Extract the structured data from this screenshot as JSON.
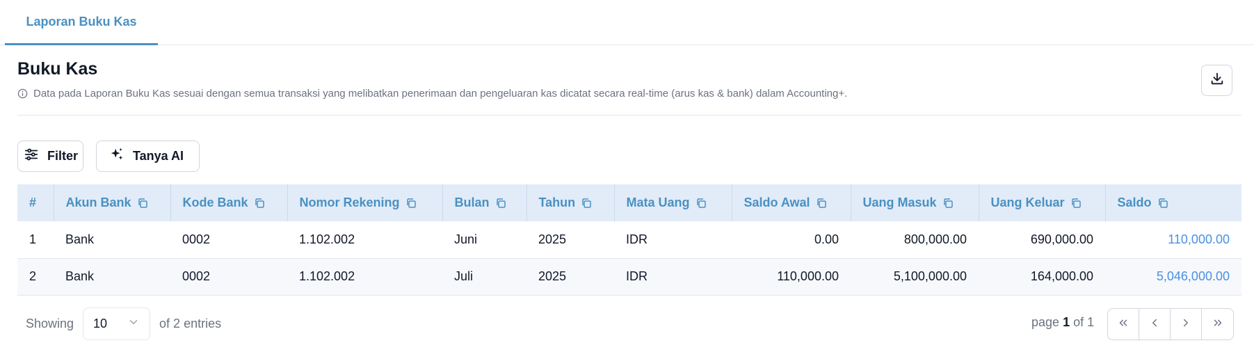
{
  "tabs": [
    {
      "label": "Laporan Buku Kas",
      "active": true
    }
  ],
  "page": {
    "title": "Buku Kas",
    "description": "Data pada Laporan Buku Kas sesuai dengan semua transaksi yang melibatkan penerimaan dan pengeluaran kas dicatat secara real-time (arus kas & bank) dalam Accounting+."
  },
  "toolbar": {
    "filter_label": "Filter",
    "ai_label": "Tanya AI"
  },
  "table": {
    "columns": [
      "#",
      "Akun Bank",
      "Kode Bank",
      "Nomor Rekening",
      "Bulan",
      "Tahun",
      "Mata Uang",
      "Saldo Awal",
      "Uang Masuk",
      "Uang Keluar",
      "Saldo"
    ],
    "rows": [
      [
        "1",
        "Bank",
        "0002",
        "1.102.002",
        "Juni",
        "2025",
        "IDR",
        "0.00",
        "800,000.00",
        "690,000.00",
        "110,000.00"
      ],
      [
        "2",
        "Bank",
        "0002",
        "1.102.002",
        "Juli",
        "2025",
        "IDR",
        "110,000.00",
        "5,100,000.00",
        "164,000.00",
        "5,046,000.00"
      ]
    ]
  },
  "footer": {
    "showing_label": "Showing",
    "page_size": "10",
    "entries_text": "of 2 entries",
    "page_label": "page",
    "current_page": "1",
    "of_label": "of",
    "total_pages": "1"
  },
  "colors": {
    "accent": "#4a90c2",
    "header_bg": "#e1ecf8",
    "link": "#4a90e2"
  }
}
